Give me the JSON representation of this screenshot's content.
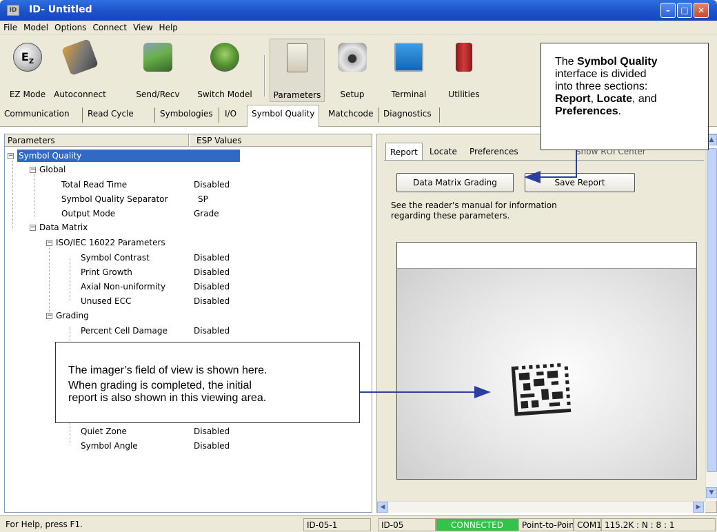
{
  "window": {
    "title": "ID- Untitled",
    "icon_text": "ID"
  },
  "menu": [
    "File",
    "Model",
    "Options",
    "Connect",
    "View",
    "Help"
  ],
  "toolbar": {
    "buttons": [
      {
        "label": "EZ Mode",
        "icon": "ez-mode-icon"
      },
      {
        "label": "Autoconnect",
        "icon": "autoconnect-icon"
      },
      {
        "label": "Send/Recv",
        "icon": "send-recv-icon"
      },
      {
        "label": "Switch Model",
        "icon": "switch-model-icon"
      },
      {
        "label": "Parameters",
        "icon": "parameters-icon"
      },
      {
        "label": "Setup",
        "icon": "camera-icon"
      },
      {
        "label": "Terminal",
        "icon": "terminal-icon"
      },
      {
        "label": "Utilities",
        "icon": "utilities-icon"
      }
    ]
  },
  "main_tabs": [
    "Communication",
    "Read Cycle",
    "Symbologies",
    "I/O",
    "Symbol Quality",
    "Matchcode",
    "Diagnostics"
  ],
  "main_tabs_active": "Symbol Quality",
  "tree": {
    "col_parameters": "Parameters",
    "col_values": "ESP Values",
    "root": "Symbol Quality",
    "global": "Global",
    "global_items": [
      {
        "name": "Total Read Time",
        "value": "Disabled"
      },
      {
        "name": "Symbol Quality Separator",
        "value": "SP"
      },
      {
        "name": "Output Mode",
        "value": "Grade"
      }
    ],
    "data_matrix": "Data Matrix",
    "iso": "ISO/IEC 16022 Parameters",
    "iso_items": [
      {
        "name": "Symbol Contrast",
        "value": "Disabled"
      },
      {
        "name": "Print Growth",
        "value": "Disabled"
      },
      {
        "name": "Axial Non-uniformity",
        "value": "Disabled"
      },
      {
        "name": "Unused ECC",
        "value": "Disabled"
      }
    ],
    "grading": "Grading",
    "grading_items": [
      {
        "name": "Percent Cell Damage",
        "value": "Disabled"
      },
      {
        "name": "Quiet Zone",
        "value": "Disabled"
      },
      {
        "name": "Symbol Angle",
        "value": "Disabled"
      }
    ]
  },
  "right": {
    "tabs": [
      "Report",
      "Locate",
      "Preferences"
    ],
    "active_tab": "Report",
    "hidden_label_fragment": "Show ROI Center",
    "grading_button": "Data Matrix Grading",
    "save_button": "Save Report",
    "info_line1": "See the reader's manual for information",
    "info_line2": "regarding these parameters."
  },
  "statusbar": {
    "help": "For Help, press F1.",
    "cell1": "ID-05-1",
    "cell2": "ID-05",
    "status": "CONNECTED",
    "mode": "Point-to-Point",
    "port": "COM1",
    "settings": "115.2K : N : 8 : 1"
  },
  "callouts": {
    "top": {
      "p1_pre": "The ",
      "p1_bold": "Symbol Quality",
      "p2": "interface is divided",
      "p3": "into three sections:",
      "p4_b1": "Report",
      "p4_mid": ", ",
      "p4_b2": "Locate",
      "p4_end": ", and",
      "p5_b": "Preferences",
      "p5_end": "."
    },
    "bottom": {
      "line1": "The imager’s field of view is shown here.",
      "line2": "When grading is completed, the initial",
      "line3": "report is also shown in this viewing area."
    }
  },
  "colors": {
    "title_bar": "#1b50c8",
    "selection": "#316ac5",
    "connected": "#34c34a",
    "arrow": "#2b3fa0"
  }
}
